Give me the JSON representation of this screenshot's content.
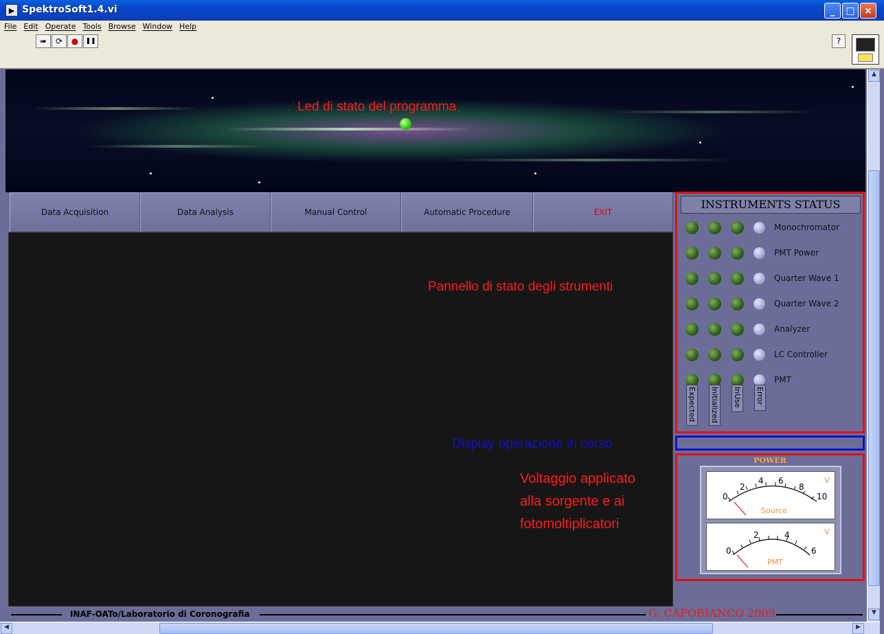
{
  "window": {
    "title": "SpektroSoft1.4.vi",
    "min": "_",
    "max": "□",
    "close": "×"
  },
  "menu": [
    "File",
    "Edit",
    "Operate",
    "Tools",
    "Browse",
    "Window",
    "Help"
  ],
  "toolbar": {
    "run": "➠",
    "run_continuous": "⟳",
    "abort": "●",
    "pause": "❚❚",
    "help": "?"
  },
  "banner": {
    "annotation": "Led di stato del programma"
  },
  "nav": [
    "Data Acquisition",
    "Data Analysis",
    "Manual Control",
    "Automatic Procedure",
    "EXIT"
  ],
  "instruments": {
    "title": "INSTRUMENTS STATUS",
    "rows": [
      "Monochromator",
      "PMT Power",
      "Quarter Wave 1",
      "Quarter Wave 2",
      "Analyzer",
      "LC Controller",
      "PMT"
    ],
    "columns": [
      "Expected",
      "Initialized",
      "InUse",
      "Error"
    ]
  },
  "annotations": {
    "instruments": "Pannello di stato degli strumenti",
    "display": "Display operazione in corso",
    "voltage1": "Voltaggio applicato",
    "voltage2": "alla sorgente e ai",
    "voltage3": "fotomoltiplicatori"
  },
  "power": {
    "title": "POWER",
    "source": {
      "label": "Source",
      "unit": "V",
      "ticks": [
        "0",
        "2",
        "4",
        "6",
        "8",
        "10"
      ],
      "value": 0
    },
    "pmt": {
      "label": "PMT",
      "unit": "V",
      "ticks": [
        "0",
        "2",
        "4",
        "6"
      ],
      "value": 0
    }
  },
  "footer": {
    "left": "INAF-OATo/Laboratorio di Coronografia",
    "right": "G. CAPOBIANCO 2009"
  },
  "colors": {
    "annotation_red": "#ff1a1a",
    "annotation_blue": "#1010c8",
    "panel_bg": "#6b6d98",
    "led_on": "#38d010"
  }
}
